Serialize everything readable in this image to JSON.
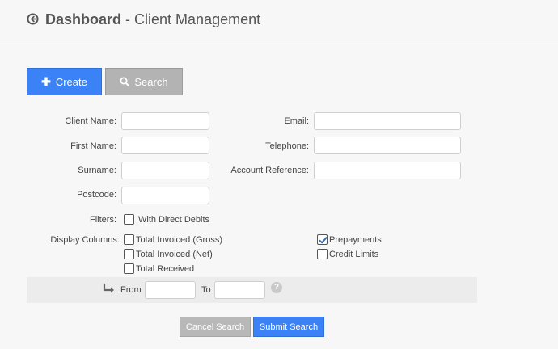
{
  "header": {
    "title_strong": "Dashboard",
    "title_sep": " - ",
    "title_rest": "Client Management",
    "back_icon": "circle-arrow-left-icon"
  },
  "toolbar": {
    "create_label": "Create",
    "search_label": "Search"
  },
  "form": {
    "client_name_label": "Client Name:",
    "email_label": "Email:",
    "first_name_label": "First Name:",
    "telephone_label": "Telephone:",
    "surname_label": "Surname:",
    "account_reference_label": "Account Reference:",
    "postcode_label": "Postcode:",
    "filters_label": "Filters:",
    "display_columns_label": "Display Columns:",
    "values": {
      "client_name": "",
      "email": "",
      "first_name": "",
      "telephone": "",
      "surname": "",
      "account_reference": "",
      "postcode": "",
      "from": "",
      "to": ""
    }
  },
  "filters": [
    {
      "label": "With Direct Debits",
      "checked": false
    }
  ],
  "display_columns": [
    {
      "label": "Total Invoiced (Gross)",
      "checked": false
    },
    {
      "label": "Total Invoiced (Net)",
      "checked": false
    },
    {
      "label": "Total Received",
      "checked": false
    },
    {
      "label": "Prepayments",
      "checked": true
    },
    {
      "label": "Credit Limits",
      "checked": false
    }
  ],
  "range": {
    "from_label": "From",
    "to_label": "To",
    "help_glyph": "?"
  },
  "actions": {
    "cancel_label": "Cancel Search",
    "submit_label": "Submit Search"
  },
  "colors": {
    "primary": "#3b82f6",
    "secondary": "#b3b3b3"
  }
}
